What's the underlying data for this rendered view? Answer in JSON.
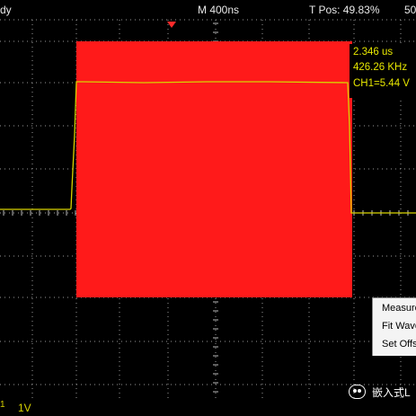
{
  "header": {
    "status_text": "dy",
    "timebase": "M 400ns",
    "trigger_position": "T Pos: 49.83%",
    "right_fragment": "50"
  },
  "readout": {
    "period": "2.346 us",
    "frequency": "426.26 KHz",
    "amplitude": "CH1=5.44 V"
  },
  "context_menu": {
    "items": [
      "Measure",
      "Fit Wave",
      "Set Offset"
    ]
  },
  "footer": {
    "channel_scale": "1V"
  },
  "watermark": {
    "text": "嵌入式L"
  },
  "colors": {
    "background": "#000000",
    "trace": "#d8d200",
    "highlight": "#ff1a1a",
    "readout_text": "#e6e600",
    "trigger_marker": "#ff2a2a"
  }
}
